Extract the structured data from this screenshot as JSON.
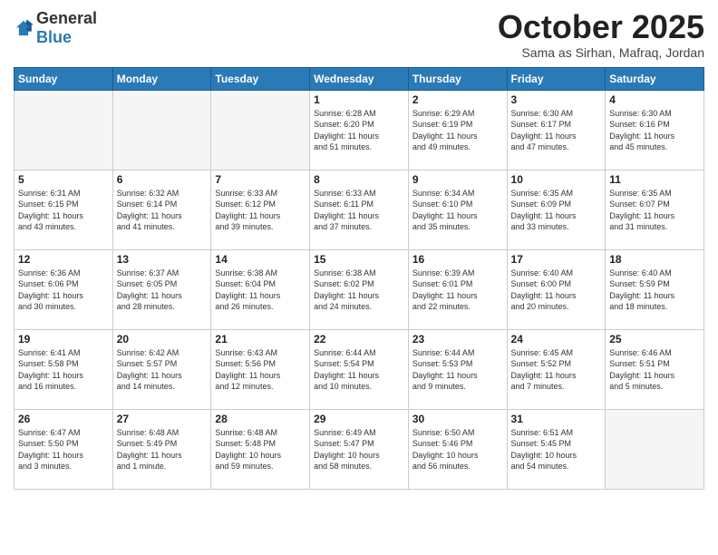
{
  "header": {
    "logo_general": "General",
    "logo_blue": "Blue",
    "month_title": "October 2025",
    "location": "Sama as Sirhan, Mafraq, Jordan"
  },
  "weekdays": [
    "Sunday",
    "Monday",
    "Tuesday",
    "Wednesday",
    "Thursday",
    "Friday",
    "Saturday"
  ],
  "weeks": [
    [
      {
        "day": "",
        "info": ""
      },
      {
        "day": "",
        "info": ""
      },
      {
        "day": "",
        "info": ""
      },
      {
        "day": "1",
        "info": "Sunrise: 6:28 AM\nSunset: 6:20 PM\nDaylight: 11 hours\nand 51 minutes."
      },
      {
        "day": "2",
        "info": "Sunrise: 6:29 AM\nSunset: 6:19 PM\nDaylight: 11 hours\nand 49 minutes."
      },
      {
        "day": "3",
        "info": "Sunrise: 6:30 AM\nSunset: 6:17 PM\nDaylight: 11 hours\nand 47 minutes."
      },
      {
        "day": "4",
        "info": "Sunrise: 6:30 AM\nSunset: 6:16 PM\nDaylight: 11 hours\nand 45 minutes."
      }
    ],
    [
      {
        "day": "5",
        "info": "Sunrise: 6:31 AM\nSunset: 6:15 PM\nDaylight: 11 hours\nand 43 minutes."
      },
      {
        "day": "6",
        "info": "Sunrise: 6:32 AM\nSunset: 6:14 PM\nDaylight: 11 hours\nand 41 minutes."
      },
      {
        "day": "7",
        "info": "Sunrise: 6:33 AM\nSunset: 6:12 PM\nDaylight: 11 hours\nand 39 minutes."
      },
      {
        "day": "8",
        "info": "Sunrise: 6:33 AM\nSunset: 6:11 PM\nDaylight: 11 hours\nand 37 minutes."
      },
      {
        "day": "9",
        "info": "Sunrise: 6:34 AM\nSunset: 6:10 PM\nDaylight: 11 hours\nand 35 minutes."
      },
      {
        "day": "10",
        "info": "Sunrise: 6:35 AM\nSunset: 6:09 PM\nDaylight: 11 hours\nand 33 minutes."
      },
      {
        "day": "11",
        "info": "Sunrise: 6:35 AM\nSunset: 6:07 PM\nDaylight: 11 hours\nand 31 minutes."
      }
    ],
    [
      {
        "day": "12",
        "info": "Sunrise: 6:36 AM\nSunset: 6:06 PM\nDaylight: 11 hours\nand 30 minutes."
      },
      {
        "day": "13",
        "info": "Sunrise: 6:37 AM\nSunset: 6:05 PM\nDaylight: 11 hours\nand 28 minutes."
      },
      {
        "day": "14",
        "info": "Sunrise: 6:38 AM\nSunset: 6:04 PM\nDaylight: 11 hours\nand 26 minutes."
      },
      {
        "day": "15",
        "info": "Sunrise: 6:38 AM\nSunset: 6:02 PM\nDaylight: 11 hours\nand 24 minutes."
      },
      {
        "day": "16",
        "info": "Sunrise: 6:39 AM\nSunset: 6:01 PM\nDaylight: 11 hours\nand 22 minutes."
      },
      {
        "day": "17",
        "info": "Sunrise: 6:40 AM\nSunset: 6:00 PM\nDaylight: 11 hours\nand 20 minutes."
      },
      {
        "day": "18",
        "info": "Sunrise: 6:40 AM\nSunset: 5:59 PM\nDaylight: 11 hours\nand 18 minutes."
      }
    ],
    [
      {
        "day": "19",
        "info": "Sunrise: 6:41 AM\nSunset: 5:58 PM\nDaylight: 11 hours\nand 16 minutes."
      },
      {
        "day": "20",
        "info": "Sunrise: 6:42 AM\nSunset: 5:57 PM\nDaylight: 11 hours\nand 14 minutes."
      },
      {
        "day": "21",
        "info": "Sunrise: 6:43 AM\nSunset: 5:56 PM\nDaylight: 11 hours\nand 12 minutes."
      },
      {
        "day": "22",
        "info": "Sunrise: 6:44 AM\nSunset: 5:54 PM\nDaylight: 11 hours\nand 10 minutes."
      },
      {
        "day": "23",
        "info": "Sunrise: 6:44 AM\nSunset: 5:53 PM\nDaylight: 11 hours\nand 9 minutes."
      },
      {
        "day": "24",
        "info": "Sunrise: 6:45 AM\nSunset: 5:52 PM\nDaylight: 11 hours\nand 7 minutes."
      },
      {
        "day": "25",
        "info": "Sunrise: 6:46 AM\nSunset: 5:51 PM\nDaylight: 11 hours\nand 5 minutes."
      }
    ],
    [
      {
        "day": "26",
        "info": "Sunrise: 6:47 AM\nSunset: 5:50 PM\nDaylight: 11 hours\nand 3 minutes."
      },
      {
        "day": "27",
        "info": "Sunrise: 6:48 AM\nSunset: 5:49 PM\nDaylight: 11 hours\nand 1 minute."
      },
      {
        "day": "28",
        "info": "Sunrise: 6:48 AM\nSunset: 5:48 PM\nDaylight: 10 hours\nand 59 minutes."
      },
      {
        "day": "29",
        "info": "Sunrise: 6:49 AM\nSunset: 5:47 PM\nDaylight: 10 hours\nand 58 minutes."
      },
      {
        "day": "30",
        "info": "Sunrise: 6:50 AM\nSunset: 5:46 PM\nDaylight: 10 hours\nand 56 minutes."
      },
      {
        "day": "31",
        "info": "Sunrise: 6:51 AM\nSunset: 5:45 PM\nDaylight: 10 hours\nand 54 minutes."
      },
      {
        "day": "",
        "info": ""
      }
    ]
  ]
}
